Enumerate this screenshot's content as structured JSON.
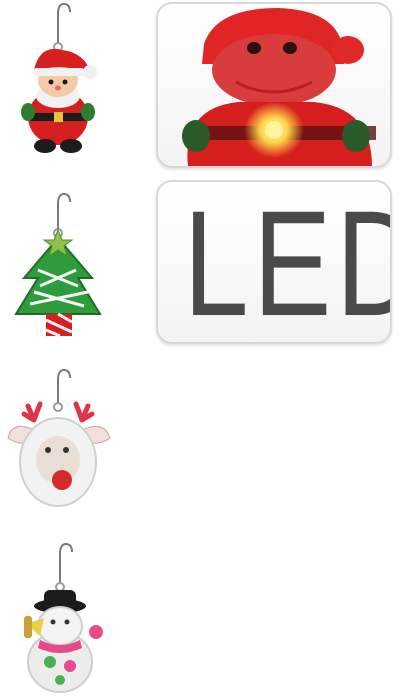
{
  "led_panel": {
    "label": "LED"
  },
  "products": [
    {
      "name": "santa-earring"
    },
    {
      "name": "christmas-tree-earring"
    },
    {
      "name": "reindeer-earring"
    },
    {
      "name": "snowman-earring"
    }
  ],
  "colors": {
    "santa_red": "#d61f1f",
    "tree_green": "#2e9b3c",
    "led_glow": "#ffd54a",
    "panel_text": "#4a4a4a"
  }
}
